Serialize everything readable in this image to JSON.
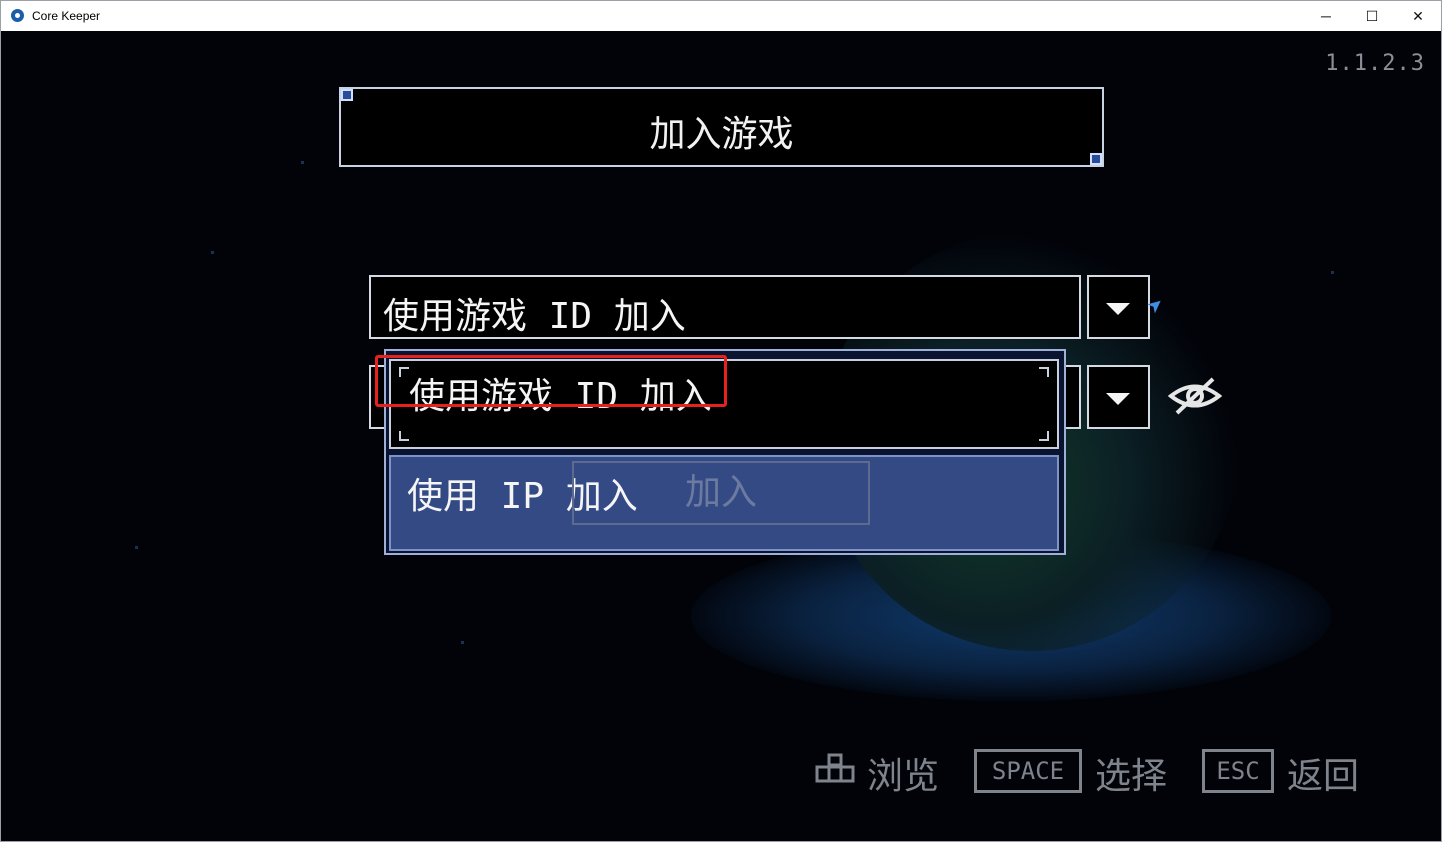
{
  "window": {
    "title": "Core Keeper",
    "minimize_glyph": "─",
    "maximize_glyph": "☐",
    "close_glyph": "✕"
  },
  "game": {
    "version": "1.1.2.3",
    "header_title": "加入游戏",
    "join_method_dropdown": {
      "value": "使用游戏 ID 加入"
    },
    "dropdown_options": [
      "使用游戏 ID 加入",
      "使用 IP 加入"
    ],
    "join_button_label": "加入",
    "hints": {
      "browse": "浏览",
      "space_key": "SPACE",
      "select": "选择",
      "esc_key": "ESC",
      "back": "返回"
    }
  },
  "colors": {
    "highlight": "#e8211c",
    "option_hover": "#344a84",
    "cursor": "#3f8fe0"
  }
}
